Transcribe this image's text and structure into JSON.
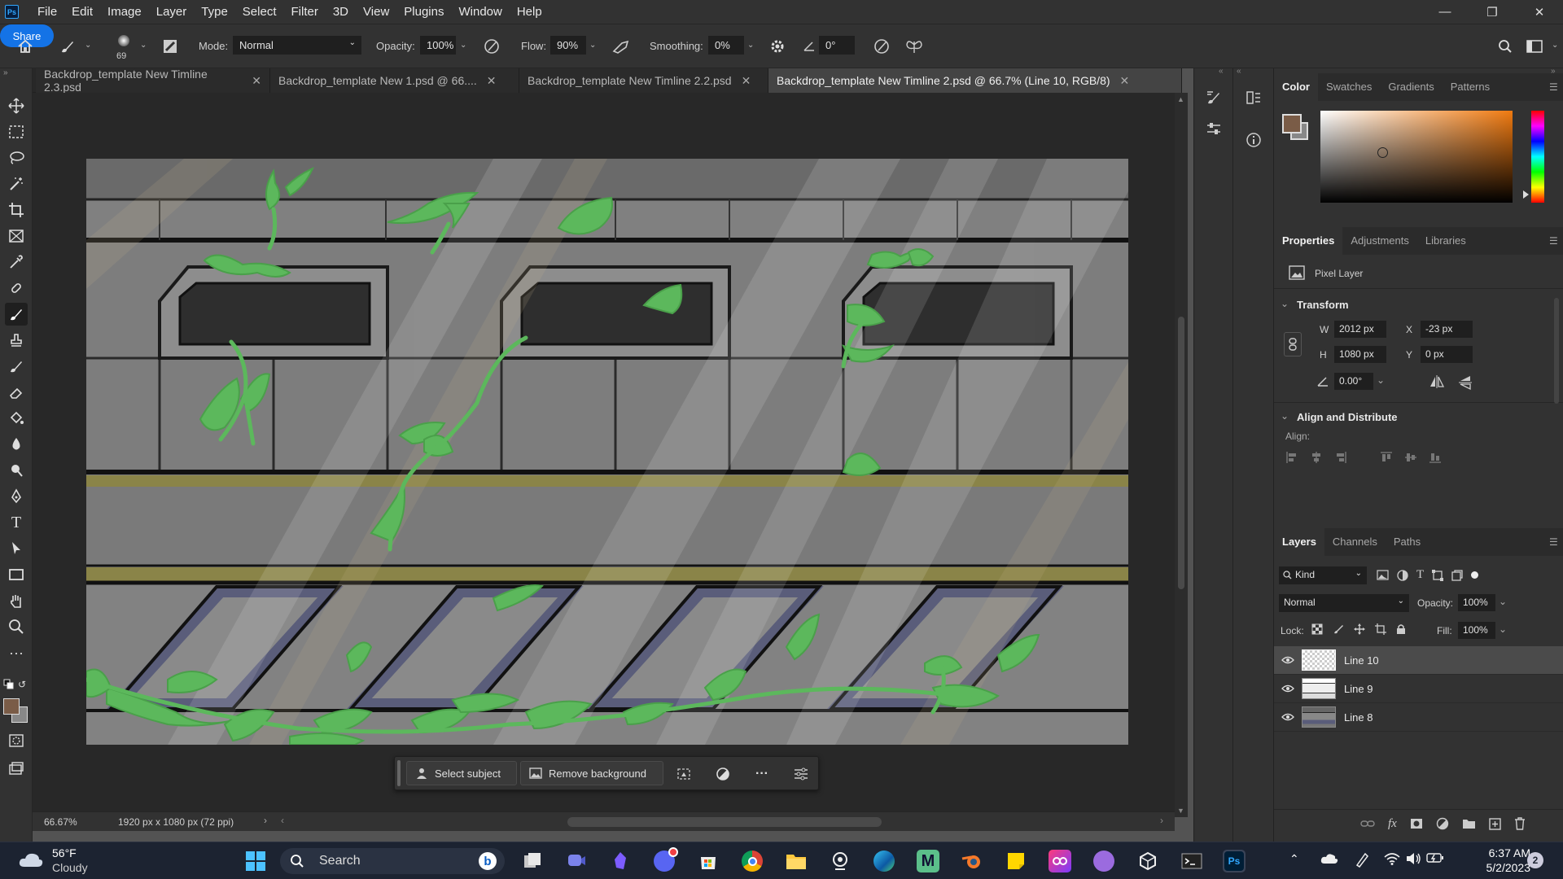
{
  "menu": {
    "items": [
      "File",
      "Edit",
      "Image",
      "Layer",
      "Type",
      "Select",
      "Filter",
      "3D",
      "View",
      "Plugins",
      "Window",
      "Help"
    ]
  },
  "app_logo": "Ps",
  "options": {
    "brush_size": "69",
    "mode_label": "Mode:",
    "mode_value": "Normal",
    "opacity_label": "Opacity:",
    "opacity_value": "100%",
    "flow_label": "Flow:",
    "flow_value": "90%",
    "smoothing_label": "Smoothing:",
    "smoothing_value": "0%",
    "angle_value": "0°",
    "share_label": "Share"
  },
  "tabs": [
    {
      "label": "Backdrop_template New Timline 2.3.psd",
      "active": false
    },
    {
      "label": "Backdrop_template New 1.psd @ 66....",
      "active": false
    },
    {
      "label": "Backdrop_template New Timline 2.2.psd",
      "active": false
    },
    {
      "label": "Backdrop_template New Timline 2.psd @ 66.7% (Line 10, RGB/8)",
      "active": true
    }
  ],
  "contextual": {
    "select_subject": "Select subject",
    "remove_background": "Remove background"
  },
  "status": {
    "zoom": "66.67%",
    "doc_info": "1920 px x 1080 px (72 ppi)"
  },
  "color_panel": {
    "tabs": [
      "Color",
      "Swatches",
      "Gradients",
      "Patterns"
    ],
    "fg": "#7a5c47",
    "bg": "#888888",
    "hue": "#f07a10"
  },
  "properties": {
    "tabs": [
      "Properties",
      "Adjustments",
      "Libraries"
    ],
    "layer_type": "Pixel Layer",
    "transform_title": "Transform",
    "w_label": "W",
    "w_value": "2012 px",
    "x_label": "X",
    "x_value": "-23 px",
    "h_label": "H",
    "h_value": "1080 px",
    "y_label": "Y",
    "y_value": "0 px",
    "angle_value": "0.00°",
    "align_title": "Align and Distribute",
    "align_label": "Align:"
  },
  "layers_panel": {
    "tabs": [
      "Layers",
      "Channels",
      "Paths"
    ],
    "filter_kind": "Kind",
    "blend_mode": "Normal",
    "opacity_label": "Opacity:",
    "opacity_value": "100%",
    "lock_label": "Lock:",
    "fill_label": "Fill:",
    "fill_value": "100%",
    "layers": [
      {
        "name": "Line 10",
        "selected": true
      },
      {
        "name": "Line 9",
        "selected": false
      },
      {
        "name": "Line 8",
        "selected": false
      }
    ]
  },
  "taskbar": {
    "weather_temp": "56°F",
    "weather_desc": "Cloudy",
    "search_label": "Search",
    "time": "6:37 AM",
    "date": "5/2/2023",
    "notification_count": "2"
  }
}
